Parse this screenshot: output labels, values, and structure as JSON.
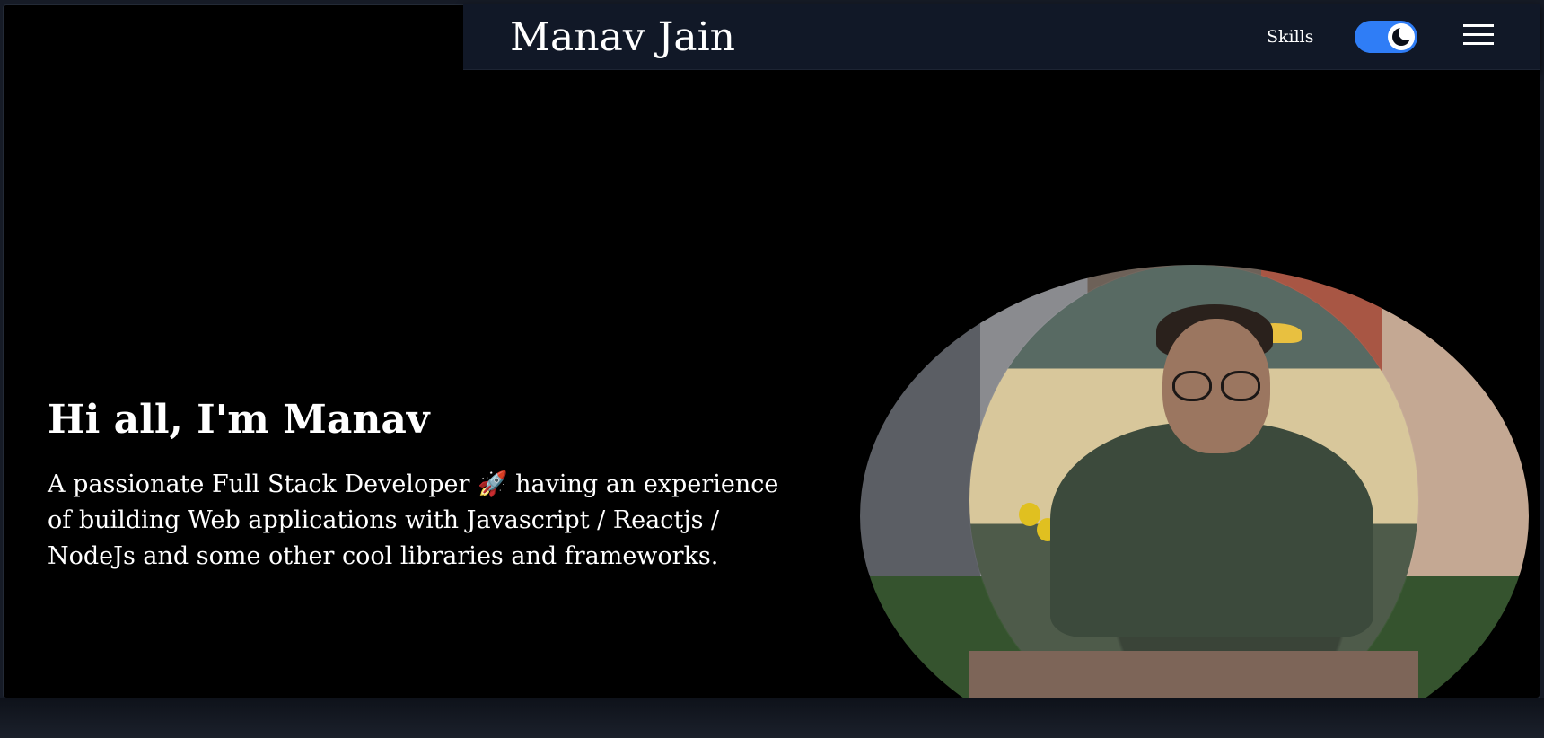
{
  "header": {
    "logo_text": "Manav Jain",
    "nav_skills": "Skills",
    "theme_toggle_state": "dark",
    "accent_color": "#2f7df6"
  },
  "hero": {
    "greeting": "Hi all, I'm Manav",
    "intro": "A passionate Full Stack Developer 🚀 having an experience of building Web applications with Javascript / Reactjs / NodeJs and some other cool libraries and frameworks."
  },
  "icons": {
    "theme": "moon-icon",
    "menu": "hamburger-menu-icon"
  }
}
